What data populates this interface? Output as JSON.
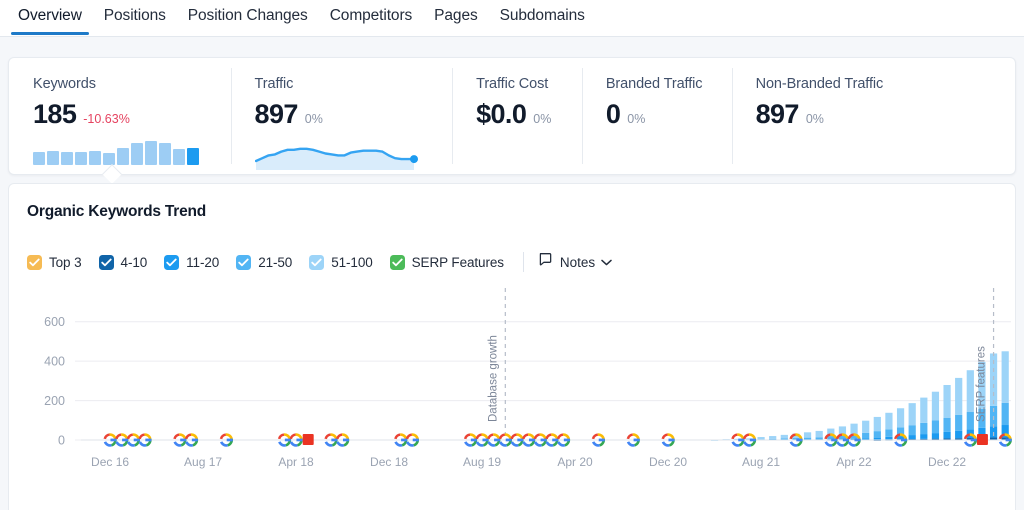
{
  "tabs": [
    {
      "label": "Overview",
      "active": true
    },
    {
      "label": "Positions",
      "active": false
    },
    {
      "label": "Position Changes",
      "active": false
    },
    {
      "label": "Competitors",
      "active": false
    },
    {
      "label": "Pages",
      "active": false
    },
    {
      "label": "Subdomains",
      "active": false
    }
  ],
  "kpis": [
    {
      "title": "Keywords",
      "value": "185",
      "delta": "-10.63%",
      "delta_kind": "neg",
      "spark": "bars"
    },
    {
      "title": "Traffic",
      "value": "897",
      "delta": "0%",
      "delta_kind": "flat",
      "spark": "area"
    },
    {
      "title": "Traffic Cost",
      "value": "$0.0",
      "delta": "0%",
      "delta_kind": "flat",
      "spark": "none"
    },
    {
      "title": "Branded Traffic",
      "value": "0",
      "delta": "0%",
      "delta_kind": "flat",
      "spark": "none"
    },
    {
      "title": "Non-Branded Traffic",
      "value": "897",
      "delta": "0%",
      "delta_kind": "flat",
      "spark": "none"
    }
  ],
  "panel": {
    "title": "Organic Keywords Trend",
    "notes_label": "Notes"
  },
  "legend": [
    {
      "label": "Top 3",
      "color": "#f6bb54"
    },
    {
      "label": "4-10",
      "color": "#1064a8"
    },
    {
      "label": "11-20",
      "color": "#1c9bf0"
    },
    {
      "label": "21-50",
      "color": "#52b5f4"
    },
    {
      "label": "51-100",
      "color": "#9dd4f8"
    },
    {
      "label": "SERP Features",
      "color": "#4cbb59"
    }
  ],
  "colors": {
    "accent": "#1e7ac8",
    "negative": "#e54360",
    "muted": "#8a94a6",
    "grid": "#ececf1",
    "top3": "#f6bb54",
    "p4_10": "#1064a8",
    "p11_20": "#1c9bf0",
    "p21_50": "#52b5f4",
    "p51_100": "#9dd4f8",
    "serp": "#4cbb59",
    "note_flag": "#ea3323"
  },
  "chart_data": {
    "type": "bar",
    "title": "Organic Keywords Trend",
    "xlabel": "",
    "ylabel": "",
    "ylim": [
      0,
      700
    ],
    "yticks": [
      0,
      200,
      400,
      600
    ],
    "grid": true,
    "legend_position": "top",
    "stacked": true,
    "xtick_labels": [
      "Dec 16",
      "Aug 17",
      "Apr 18",
      "Dec 18",
      "Aug 19",
      "Apr 20",
      "Dec 20",
      "Aug 21",
      "Apr 22",
      "Dec 22"
    ],
    "xtick_index": [
      2,
      10,
      18,
      26,
      34,
      42,
      50,
      58,
      66,
      74
    ],
    "series": [
      {
        "name": "Top 3",
        "color": "#f6bb54",
        "values": [
          0,
          0,
          0,
          0,
          0,
          0,
          0,
          0,
          0,
          0,
          0,
          0,
          0,
          0,
          0,
          0,
          0,
          0,
          0,
          0,
          0,
          0,
          0,
          0,
          0,
          0,
          0,
          0,
          0,
          0,
          0,
          0,
          0,
          0,
          0,
          0,
          0,
          0,
          0,
          0,
          0,
          0,
          0,
          0,
          0,
          0,
          0,
          0,
          0,
          0,
          0,
          0,
          0,
          0,
          0,
          0,
          0,
          0,
          0,
          0,
          0,
          0,
          0,
          0,
          0,
          0,
          0,
          0,
          0,
          0,
          0,
          0,
          0,
          0,
          0,
          0,
          0,
          0,
          0,
          0
        ]
      },
      {
        "name": "4-10",
        "color": "#1064a8",
        "values": [
          0,
          0,
          0,
          0,
          0,
          0,
          0,
          0,
          0,
          0,
          0,
          0,
          0,
          0,
          0,
          0,
          0,
          0,
          0,
          0,
          0,
          0,
          0,
          0,
          0,
          0,
          0,
          0,
          0,
          0,
          0,
          0,
          0,
          0,
          0,
          0,
          0,
          0,
          0,
          0,
          0,
          0,
          0,
          0,
          0,
          0,
          0,
          0,
          0,
          0,
          0,
          0,
          0,
          0,
          0,
          0,
          0,
          0,
          0,
          0,
          0,
          0,
          0,
          0,
          0,
          0,
          0,
          0,
          2,
          3,
          4,
          5,
          6,
          7,
          8,
          9,
          10,
          12,
          13,
          14
        ]
      },
      {
        "name": "11-20",
        "color": "#1c9bf0",
        "values": [
          0,
          0,
          0,
          0,
          0,
          0,
          0,
          0,
          0,
          0,
          0,
          0,
          0,
          0,
          0,
          0,
          0,
          0,
          0,
          0,
          0,
          0,
          0,
          0,
          0,
          0,
          0,
          0,
          0,
          0,
          0,
          0,
          0,
          0,
          0,
          0,
          0,
          0,
          0,
          0,
          0,
          0,
          0,
          0,
          0,
          0,
          0,
          0,
          0,
          0,
          0,
          0,
          0,
          0,
          0,
          0,
          0,
          0,
          0,
          0,
          0,
          0,
          0,
          0,
          3,
          4,
          6,
          8,
          10,
          13,
          16,
          20,
          24,
          28,
          33,
          38,
          44,
          50,
          56,
          62
        ]
      },
      {
        "name": "21-50",
        "color": "#52b5f4",
        "values": [
          0,
          0,
          0,
          0,
          0,
          0,
          0,
          0,
          0,
          0,
          0,
          0,
          0,
          0,
          0,
          0,
          0,
          0,
          0,
          0,
          0,
          0,
          0,
          0,
          0,
          0,
          0,
          0,
          0,
          0,
          0,
          0,
          0,
          0,
          0,
          0,
          0,
          0,
          0,
          0,
          0,
          0,
          0,
          0,
          0,
          0,
          0,
          0,
          0,
          0,
          0,
          0,
          0,
          0,
          0,
          0,
          0,
          0,
          4,
          6,
          8,
          10,
          12,
          14,
          17,
          20,
          24,
          28,
          33,
          38,
          44,
          50,
          57,
          64,
          72,
          80,
          88,
          96,
          104,
          112
        ]
      },
      {
        "name": "51-100",
        "color": "#9dd4f8",
        "values": [
          0,
          0,
          0,
          0,
          0,
          0,
          0,
          0,
          0,
          0,
          0,
          0,
          0,
          0,
          0,
          0,
          0,
          0,
          0,
          0,
          0,
          0,
          0,
          0,
          0,
          0,
          0,
          0,
          0,
          0,
          0,
          0,
          0,
          0,
          0,
          0,
          0,
          0,
          0,
          0,
          0,
          0,
          0,
          0,
          0,
          0,
          0,
          0,
          0,
          0,
          0,
          0,
          0,
          0,
          2,
          4,
          6,
          8,
          11,
          14,
          18,
          22,
          27,
          32,
          38,
          45,
          53,
          62,
          72,
          84,
          97,
          112,
          128,
          146,
          166,
          188,
          212,
          238,
          266,
          262
        ]
      }
    ],
    "annotations": [
      {
        "label": "Database growth",
        "x_index": 36
      },
      {
        "label": "SERP features",
        "x_index": 78
      }
    ],
    "google_markers_index": [
      2,
      3,
      4,
      5,
      8,
      9,
      12,
      17,
      18,
      21,
      22,
      27,
      28,
      33,
      34,
      35,
      36,
      37,
      38,
      39,
      40,
      41,
      44,
      47,
      50,
      56,
      57,
      61,
      64,
      65,
      66,
      70,
      76,
      79
    ],
    "note_flags_index": [
      19,
      77
    ]
  }
}
